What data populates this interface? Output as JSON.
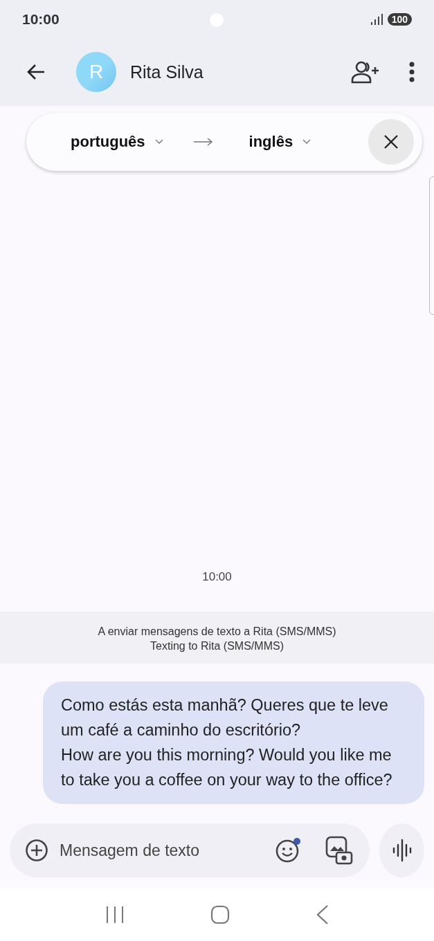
{
  "status_bar": {
    "time": "10:00",
    "battery": "100"
  },
  "app_bar": {
    "avatar_letter": "R",
    "contact_name": "Rita Silva"
  },
  "translate_bar": {
    "source_language": "português",
    "target_language": "inglês"
  },
  "conversation": {
    "timestamp": "10:00",
    "info_lines": [
      "A enviar mensagens de texto a Rita (SMS/MMS)",
      "Texting to Rita (SMS/MMS)"
    ],
    "messages": [
      {
        "kind": "outgoing",
        "text": "Como estás esta manhã? Queres que te leve um café a caminho do escritório?\nHow are you this morning? Would you like me to take you a coffee on your way to the office?"
      }
    ]
  },
  "composer": {
    "placeholder": "Mensagem de texto",
    "emoji_badge": true
  }
}
